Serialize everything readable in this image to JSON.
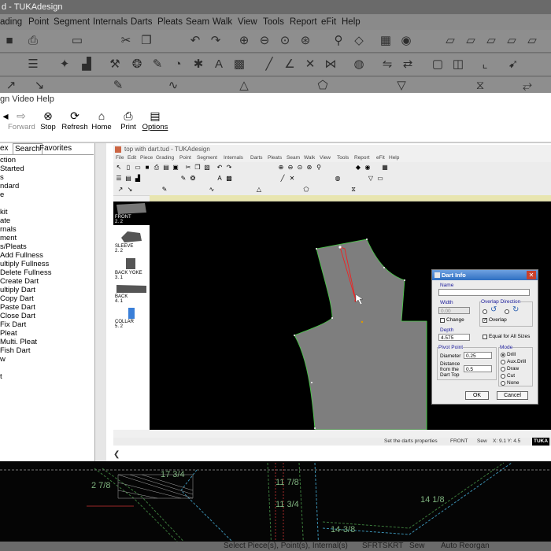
{
  "bg_app": {
    "title": "d - TUKAdesign",
    "menu": [
      "ading",
      "Point",
      "Segment",
      "Internals",
      "Darts",
      "Pleats",
      "Seam",
      "Walk",
      "View",
      "Tools",
      "Report",
      "eFit",
      "Help"
    ],
    "canvas_labels": [
      "17 3/4",
      "2 7/8",
      "11 7/8",
      "11 3/4",
      "14 1/8",
      "14-3/8"
    ],
    "status": [
      "Select Piece(s), Point(s), Internal(s)",
      "SFRTSKRT",
      "Sew",
      "Auto Reorgan"
    ]
  },
  "help_window": {
    "title": "gn Video Help",
    "toolbar": [
      {
        "label": "",
        "icon": "◂"
      },
      {
        "label": "Forward",
        "icon": "⇨",
        "disabled": true
      },
      {
        "label": "Stop",
        "icon": "⊗"
      },
      {
        "label": "Refresh",
        "icon": "⟳"
      },
      {
        "label": "Home",
        "icon": "⌂"
      },
      {
        "label": "Print",
        "icon": "⎙"
      },
      {
        "label": "Options",
        "icon": "▤"
      }
    ],
    "tabs": [
      "ex",
      "Search",
      "Favorites"
    ],
    "topics": [
      "ction",
      "Started",
      "s",
      "ndard",
      "e",
      "",
      "kit",
      "ate",
      "rnals",
      "ment",
      "s/Pleats",
      "Add Fullness",
      "ultiply Fullness",
      "Delete Fullness",
      "Create Dart",
      "ultiply Dart",
      "Copy Dart",
      "Paste Dart",
      "Close Dart",
      "Fix Dart",
      "Pleat",
      "Multi. Pleat",
      "Fish Dart",
      "w",
      "",
      "t"
    ]
  },
  "video": {
    "title": "top with dart.tud - TUKAdesign",
    "menu": [
      "File",
      "Edit",
      "Piece",
      "Grading",
      "Point",
      "Segment",
      "Internals",
      "Darts",
      "Pleats",
      "Seam",
      "Walk",
      "View",
      "Tools",
      "Report",
      "eFit",
      "Help"
    ],
    "pieces": [
      {
        "name": "FRONT",
        "count": "2. 2"
      },
      {
        "name": "SLEEVE",
        "count": "2. 2"
      },
      {
        "name": "BACK YOKE",
        "count": "3. 1"
      },
      {
        "name": "BACK",
        "count": "4. 1"
      },
      {
        "name": "COLLAR",
        "count": "5. 2"
      }
    ],
    "status": [
      "Set the darts properties",
      "FRONT",
      "Sew",
      "X: 9.1  Y: 4.5",
      "TUKA"
    ]
  },
  "dart_info": {
    "title": "Dart Info",
    "name_label": "Name",
    "name_value": "",
    "width_label": "Width",
    "width_value": "0.00",
    "change_label": "Change",
    "overlap_dir_label": "Overlap Direction",
    "overlap_label": "Overlap",
    "depth_label": "Depth",
    "depth_value": "4.575",
    "equal_label": "Equal for All Sizes",
    "pivot_label": "Pivot Point",
    "diameter_label": "Diameter",
    "diameter_value": "0.25",
    "distance_label_1": "Distance",
    "distance_label_2": "from the",
    "distance_label_3": "Dart Top",
    "distance_value": "0.5",
    "mode_label": "Mode",
    "modes": [
      "Drill",
      "Aux.Drill",
      "Draw",
      "Cut",
      "None"
    ],
    "ok_label": "OK",
    "cancel_label": "Cancel"
  }
}
